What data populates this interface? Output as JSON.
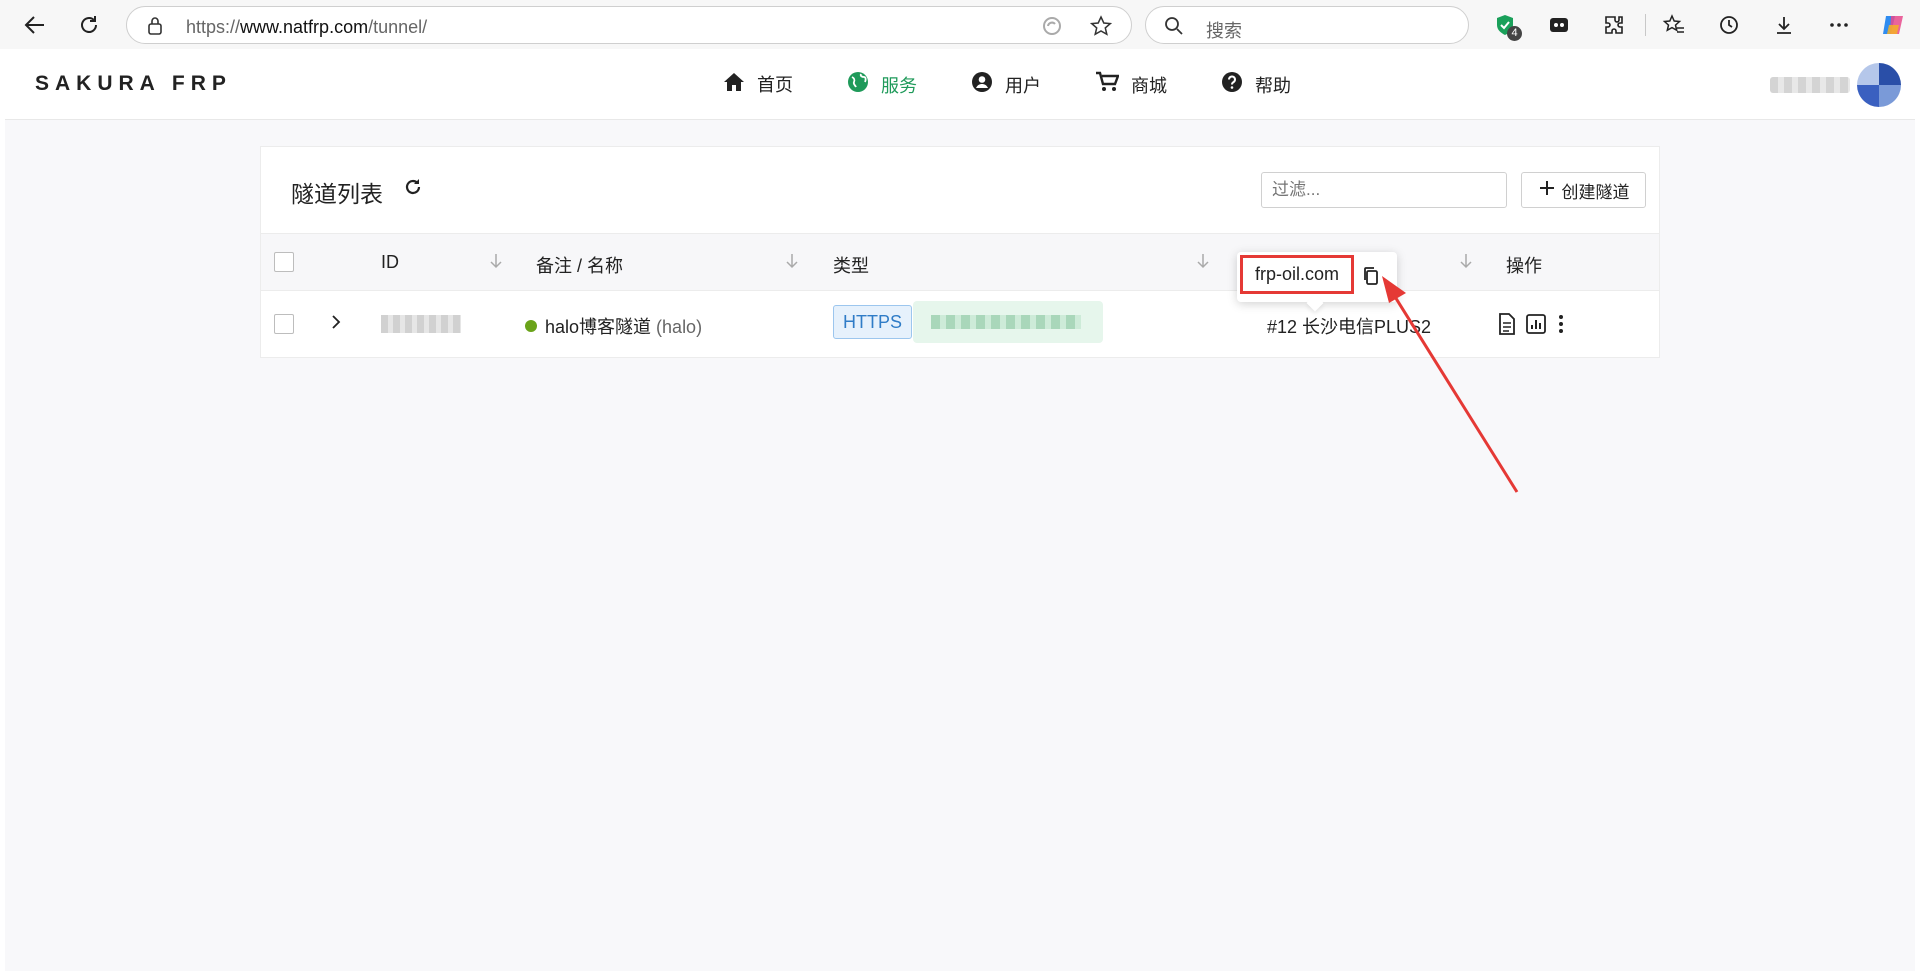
{
  "browser": {
    "url_scheme": "https://",
    "url_host": "www.natfrp.com",
    "url_path": "/tunnel/",
    "search_placeholder": "搜索",
    "extension_badge": "4"
  },
  "site": {
    "logo": "SAKURA FRP",
    "nav": [
      {
        "label": "首页",
        "icon": "home-icon"
      },
      {
        "label": "服务",
        "icon": "globe-icon"
      },
      {
        "label": "用户",
        "icon": "user-circle-icon"
      },
      {
        "label": "商城",
        "icon": "cart-icon"
      },
      {
        "label": "帮助",
        "icon": "help-circle-icon"
      }
    ],
    "active_color": "#1f9a5a"
  },
  "tunnel_list": {
    "title": "隧道列表",
    "filter_placeholder": "过滤...",
    "create_label": "创建隧道",
    "columns": [
      "ID",
      "备注 / 名称",
      "类型",
      "",
      "操作"
    ],
    "rows": [
      {
        "id": "",
        "name": "halo博客隧道",
        "alias": "(halo)",
        "status_color": "#6aa31a",
        "type": "HTTPS",
        "domain": "",
        "node": "#12 长沙电信PLUS2"
      }
    ]
  },
  "tooltip": {
    "text": "frp-oil.com"
  }
}
